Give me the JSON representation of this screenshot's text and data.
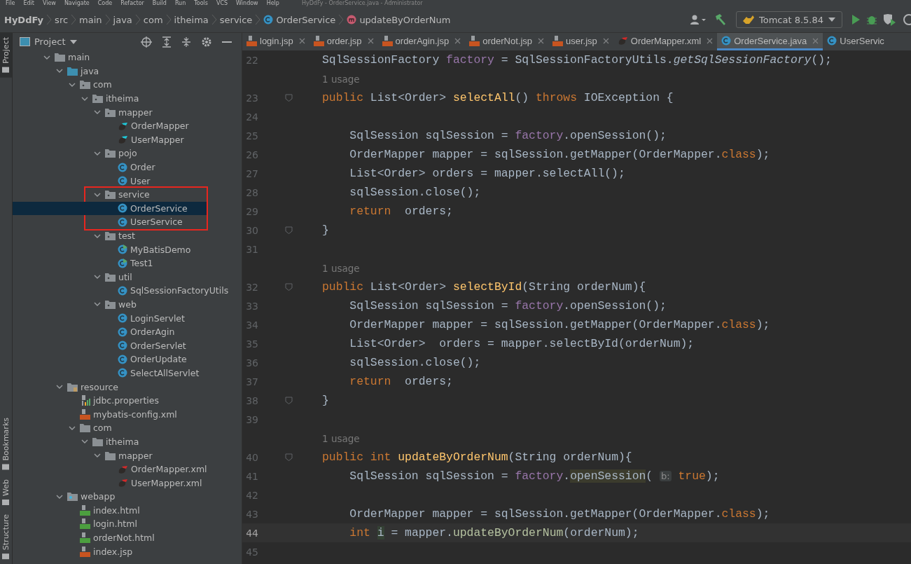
{
  "menu_bar": {
    "items": [
      "File",
      "Edit",
      "View",
      "Navigate",
      "Code",
      "Refactor",
      "Build",
      "Run",
      "Tools",
      "VCS",
      "Window",
      "Help"
    ],
    "title": "HyDdFy - OrderService.java - Administrator"
  },
  "breadcrumbs": [
    {
      "label": "HyDdFy",
      "kind": "project"
    },
    {
      "label": "src",
      "kind": "dir"
    },
    {
      "label": "main",
      "kind": "dir"
    },
    {
      "label": "java",
      "kind": "dir"
    },
    {
      "label": "com",
      "kind": "dir"
    },
    {
      "label": "itheima",
      "kind": "dir"
    },
    {
      "label": "service",
      "kind": "dir"
    },
    {
      "label": "OrderService",
      "kind": "class"
    },
    {
      "label": "updateByOrderNum",
      "kind": "method"
    }
  ],
  "run_config": {
    "label": "Tomcat 8.5.84"
  },
  "side_tabs": [
    {
      "label": "Project",
      "selected": true,
      "kind": "top"
    },
    {
      "label": "Bookmarks",
      "selected": false,
      "kind": "bottom"
    },
    {
      "label": "Web",
      "selected": false,
      "kind": "bottom"
    },
    {
      "label": "Structure",
      "selected": false,
      "kind": "bottom"
    }
  ],
  "project_panel": {
    "title": "Project"
  },
  "tree": [
    {
      "label": "main",
      "kind": "folder",
      "expanded": true,
      "children": [
        {
          "label": "java",
          "kind": "source",
          "expanded": true,
          "children": [
            {
              "label": "com",
              "kind": "package",
              "expanded": true,
              "children": [
                {
                  "label": "itheima",
                  "kind": "package",
                  "expanded": true,
                  "children": [
                    {
                      "label": "mapper",
                      "kind": "package",
                      "expanded": true,
                      "children": [
                        {
                          "label": "OrderMapper",
                          "kind": "mybatis",
                          "selected": false
                        },
                        {
                          "label": "UserMapper",
                          "kind": "mybatis",
                          "selected": false
                        }
                      ]
                    },
                    {
                      "label": "pojo",
                      "kind": "package",
                      "expanded": true,
                      "children": [
                        {
                          "label": "Order",
                          "kind": "class",
                          "selected": false
                        },
                        {
                          "label": "User",
                          "kind": "class",
                          "selected": false
                        }
                      ]
                    },
                    {
                      "label": "service",
                      "kind": "package",
                      "expanded": true,
                      "highlighted": true,
                      "children": [
                        {
                          "label": "OrderService",
                          "kind": "class",
                          "selected": true
                        },
                        {
                          "label": "UserService",
                          "kind": "class",
                          "selected": false
                        }
                      ]
                    },
                    {
                      "label": "test",
                      "kind": "package",
                      "expanded": true,
                      "children": [
                        {
                          "label": "MyBatisDemo",
                          "kind": "test",
                          "selected": false
                        },
                        {
                          "label": "Test1",
                          "kind": "test",
                          "selected": false
                        }
                      ]
                    },
                    {
                      "label": "util",
                      "kind": "package",
                      "expanded": true,
                      "children": [
                        {
                          "label": "SqlSessionFactoryUtils",
                          "kind": "class",
                          "selected": false
                        }
                      ]
                    },
                    {
                      "label": "web",
                      "kind": "package",
                      "expanded": true,
                      "children": [
                        {
                          "label": "LoginServlet",
                          "kind": "class",
                          "selected": false
                        },
                        {
                          "label": "OrderAgin",
                          "kind": "class",
                          "selected": false
                        },
                        {
                          "label": "OrderServlet",
                          "kind": "class",
                          "selected": false
                        },
                        {
                          "label": "OrderUpdate",
                          "kind": "class",
                          "selected": false
                        },
                        {
                          "label": "SelectAllServlet",
                          "kind": "class",
                          "selected": false
                        }
                      ]
                    }
                  ]
                }
              ]
            }
          ]
        },
        {
          "label": "resource",
          "kind": "resource",
          "expanded": true,
          "children": [
            {
              "label": "jdbc.properties",
              "kind": "properties",
              "selected": false
            },
            {
              "label": "mybatis-config.xml",
              "kind": "xml",
              "selected": false
            },
            {
              "label": "com",
              "kind": "folder",
              "expanded": true,
              "children": [
                {
                  "label": "itheima",
                  "kind": "folder",
                  "expanded": true,
                  "children": [
                    {
                      "label": "mapper",
                      "kind": "folder",
                      "expanded": true,
                      "children": [
                        {
                          "label": "OrderMapper.xml",
                          "kind": "mybatis-xml",
                          "selected": false
                        },
                        {
                          "label": "UserMapper.xml",
                          "kind": "mybatis-xml",
                          "selected": false
                        }
                      ]
                    }
                  ]
                }
              ]
            }
          ]
        },
        {
          "label": "webapp",
          "kind": "web",
          "expanded": true,
          "children": [
            {
              "label": "index.html",
              "kind": "html",
              "selected": false
            },
            {
              "label": "login.html",
              "kind": "html",
              "selected": false
            },
            {
              "label": "orderNot.html",
              "kind": "html",
              "selected": false
            },
            {
              "label": "index.jsp",
              "kind": "jsp",
              "selected": false
            }
          ]
        }
      ]
    }
  ],
  "editor_tabs": [
    {
      "label": "login.jsp",
      "kind": "jsp",
      "selected": false,
      "closable": true
    },
    {
      "label": "order.jsp",
      "kind": "jsp",
      "selected": false,
      "closable": true
    },
    {
      "label": "orderAgin.jsp",
      "kind": "jsp",
      "selected": false,
      "closable": true
    },
    {
      "label": "orderNot.jsp",
      "kind": "jsp",
      "selected": false,
      "closable": true
    },
    {
      "label": "user.jsp",
      "kind": "jsp",
      "selected": false,
      "closable": true
    },
    {
      "label": "OrderMapper.xml",
      "kind": "mybatis-xml",
      "selected": false,
      "closable": true
    },
    {
      "label": "OrderService.java",
      "kind": "class",
      "selected": true,
      "closable": true
    },
    {
      "label": "UserServic",
      "kind": "class",
      "selected": false,
      "closable": false
    }
  ],
  "code_lines": [
    {
      "kind": "code",
      "number": "22",
      "current": false,
      "fold": false,
      "tokens": [
        {
          "t": "SqlSessionFactory ",
          "kind": "plain"
        },
        {
          "t": "factory",
          "kind": "field"
        },
        {
          "t": " = SqlSessionFactoryUtils.",
          "kind": "plain"
        },
        {
          "t": "getSqlSessionFactory",
          "kind": "static"
        },
        {
          "t": "();",
          "kind": "plain"
        }
      ]
    },
    {
      "kind": "usage",
      "text": "1 usage"
    },
    {
      "kind": "code",
      "number": "23",
      "current": false,
      "fold": true,
      "tokens": [
        {
          "t": "public ",
          "kind": "kw"
        },
        {
          "t": "List<Order> ",
          "kind": "plain"
        },
        {
          "t": "selectAll",
          "kind": "decl"
        },
        {
          "t": "() ",
          "kind": "plain"
        },
        {
          "t": "throws ",
          "kind": "kw"
        },
        {
          "t": "IOException {",
          "kind": "plain"
        }
      ]
    },
    {
      "kind": "code",
      "number": "24",
      "current": false,
      "fold": false
    },
    {
      "kind": "code",
      "number": "25",
      "current": false,
      "fold": false,
      "tokens": [
        {
          "t": "    SqlSession sqlSession = ",
          "kind": "plain"
        },
        {
          "t": "factory",
          "kind": "field"
        },
        {
          "t": ".openSession();",
          "kind": "plain"
        }
      ]
    },
    {
      "kind": "code",
      "number": "26",
      "current": false,
      "fold": false,
      "tokens": [
        {
          "t": "    OrderMapper mapper = sqlSession.getMapper(OrderMapper.",
          "kind": "plain"
        },
        {
          "t": "class",
          "kind": "kw"
        },
        {
          "t": ");",
          "kind": "plain"
        }
      ]
    },
    {
      "kind": "code",
      "number": "27",
      "current": false,
      "fold": false,
      "tokens": [
        {
          "t": "    List<Order> orders = mapper.selectAll();",
          "kind": "plain"
        }
      ]
    },
    {
      "kind": "code",
      "number": "28",
      "current": false,
      "fold": false,
      "tokens": [
        {
          "t": "    sqlSession.close();",
          "kind": "plain"
        }
      ]
    },
    {
      "kind": "code",
      "number": "29",
      "current": false,
      "fold": false,
      "tokens": [
        {
          "t": "    return  ",
          "kind": "kw"
        },
        {
          "t": "orders;",
          "kind": "plain"
        }
      ]
    },
    {
      "kind": "code",
      "number": "30",
      "current": false,
      "fold": true,
      "tokens": [
        {
          "t": "}",
          "kind": "plain"
        }
      ]
    },
    {
      "kind": "code",
      "number": "31",
      "current": false,
      "fold": false
    },
    {
      "kind": "usage",
      "text": "1 usage"
    },
    {
      "kind": "code",
      "number": "32",
      "current": false,
      "fold": true,
      "tokens": [
        {
          "t": "public ",
          "kind": "kw"
        },
        {
          "t": "List<Order> ",
          "kind": "plain"
        },
        {
          "t": "selectById",
          "kind": "decl"
        },
        {
          "t": "(String orderNum){",
          "kind": "plain"
        }
      ]
    },
    {
      "kind": "code",
      "number": "33",
      "current": false,
      "fold": false,
      "tokens": [
        {
          "t": "    SqlSession sqlSession = ",
          "kind": "plain"
        },
        {
          "t": "factory",
          "kind": "field"
        },
        {
          "t": ".openSession();",
          "kind": "plain"
        }
      ]
    },
    {
      "kind": "code",
      "number": "34",
      "current": false,
      "fold": false,
      "tokens": [
        {
          "t": "    OrderMapper mapper = sqlSession.getMapper(OrderMapper.",
          "kind": "plain"
        },
        {
          "t": "class",
          "kind": "kw"
        },
        {
          "t": ");",
          "kind": "plain"
        }
      ]
    },
    {
      "kind": "code",
      "number": "35",
      "current": false,
      "fold": false,
      "tokens": [
        {
          "t": "    List<Order>  orders = mapper.selectById(orderNum);",
          "kind": "plain"
        }
      ]
    },
    {
      "kind": "code",
      "number": "36",
      "current": false,
      "fold": false,
      "tokens": [
        {
          "t": "    sqlSession.close();",
          "kind": "plain"
        }
      ]
    },
    {
      "kind": "code",
      "number": "37",
      "current": false,
      "fold": false,
      "tokens": [
        {
          "t": "    return  ",
          "kind": "kw"
        },
        {
          "t": "orders;",
          "kind": "plain"
        }
      ]
    },
    {
      "kind": "code",
      "number": "38",
      "current": false,
      "fold": true,
      "tokens": [
        {
          "t": "}",
          "kind": "plain"
        }
      ]
    },
    {
      "kind": "code",
      "number": "39",
      "current": false,
      "fold": false
    },
    {
      "kind": "usage",
      "text": "1 usage"
    },
    {
      "kind": "code",
      "number": "40",
      "current": false,
      "fold": true,
      "tokens": [
        {
          "t": "public int ",
          "kind": "kw"
        },
        {
          "t": "updateByOrderNum",
          "kind": "decl"
        },
        {
          "t": "(String orderNum){",
          "kind": "plain"
        }
      ]
    },
    {
      "kind": "code",
      "number": "41",
      "current": false,
      "fold": false,
      "tokens": [
        {
          "t": "    SqlSession sqlSession = ",
          "kind": "plain"
        },
        {
          "t": "factory",
          "kind": "field"
        },
        {
          "t": ".",
          "kind": "plain"
        },
        {
          "t": "openSession",
          "kind": "mark"
        },
        {
          "t": "( ",
          "kind": "plain"
        },
        {
          "t": "b:",
          "kind": "hint"
        },
        {
          "t": " true",
          "kind": "kw"
        },
        {
          "t": ");",
          "kind": "plain"
        }
      ]
    },
    {
      "kind": "code",
      "number": "42",
      "current": false,
      "fold": false
    },
    {
      "kind": "code",
      "number": "43",
      "current": false,
      "fold": false,
      "tokens": [
        {
          "t": "    OrderMapper mapper = sqlSession.getMapper(OrderMapper.",
          "kind": "plain"
        },
        {
          "t": "class",
          "kind": "kw"
        },
        {
          "t": ");",
          "kind": "plain"
        }
      ]
    },
    {
      "kind": "code",
      "number": "44",
      "current": true,
      "fold": false,
      "tokens": [
        {
          "t": "    int ",
          "kind": "kw"
        },
        {
          "t": "i",
          "kind": "var"
        },
        {
          "t": " = mapper.",
          "kind": "plain"
        },
        {
          "t": "updateByOrderNum",
          "kind": "call"
        },
        {
          "t": "(orderNum);",
          "kind": "plain"
        }
      ]
    },
    {
      "kind": "code",
      "number": "45",
      "current": false,
      "fold": false
    }
  ]
}
